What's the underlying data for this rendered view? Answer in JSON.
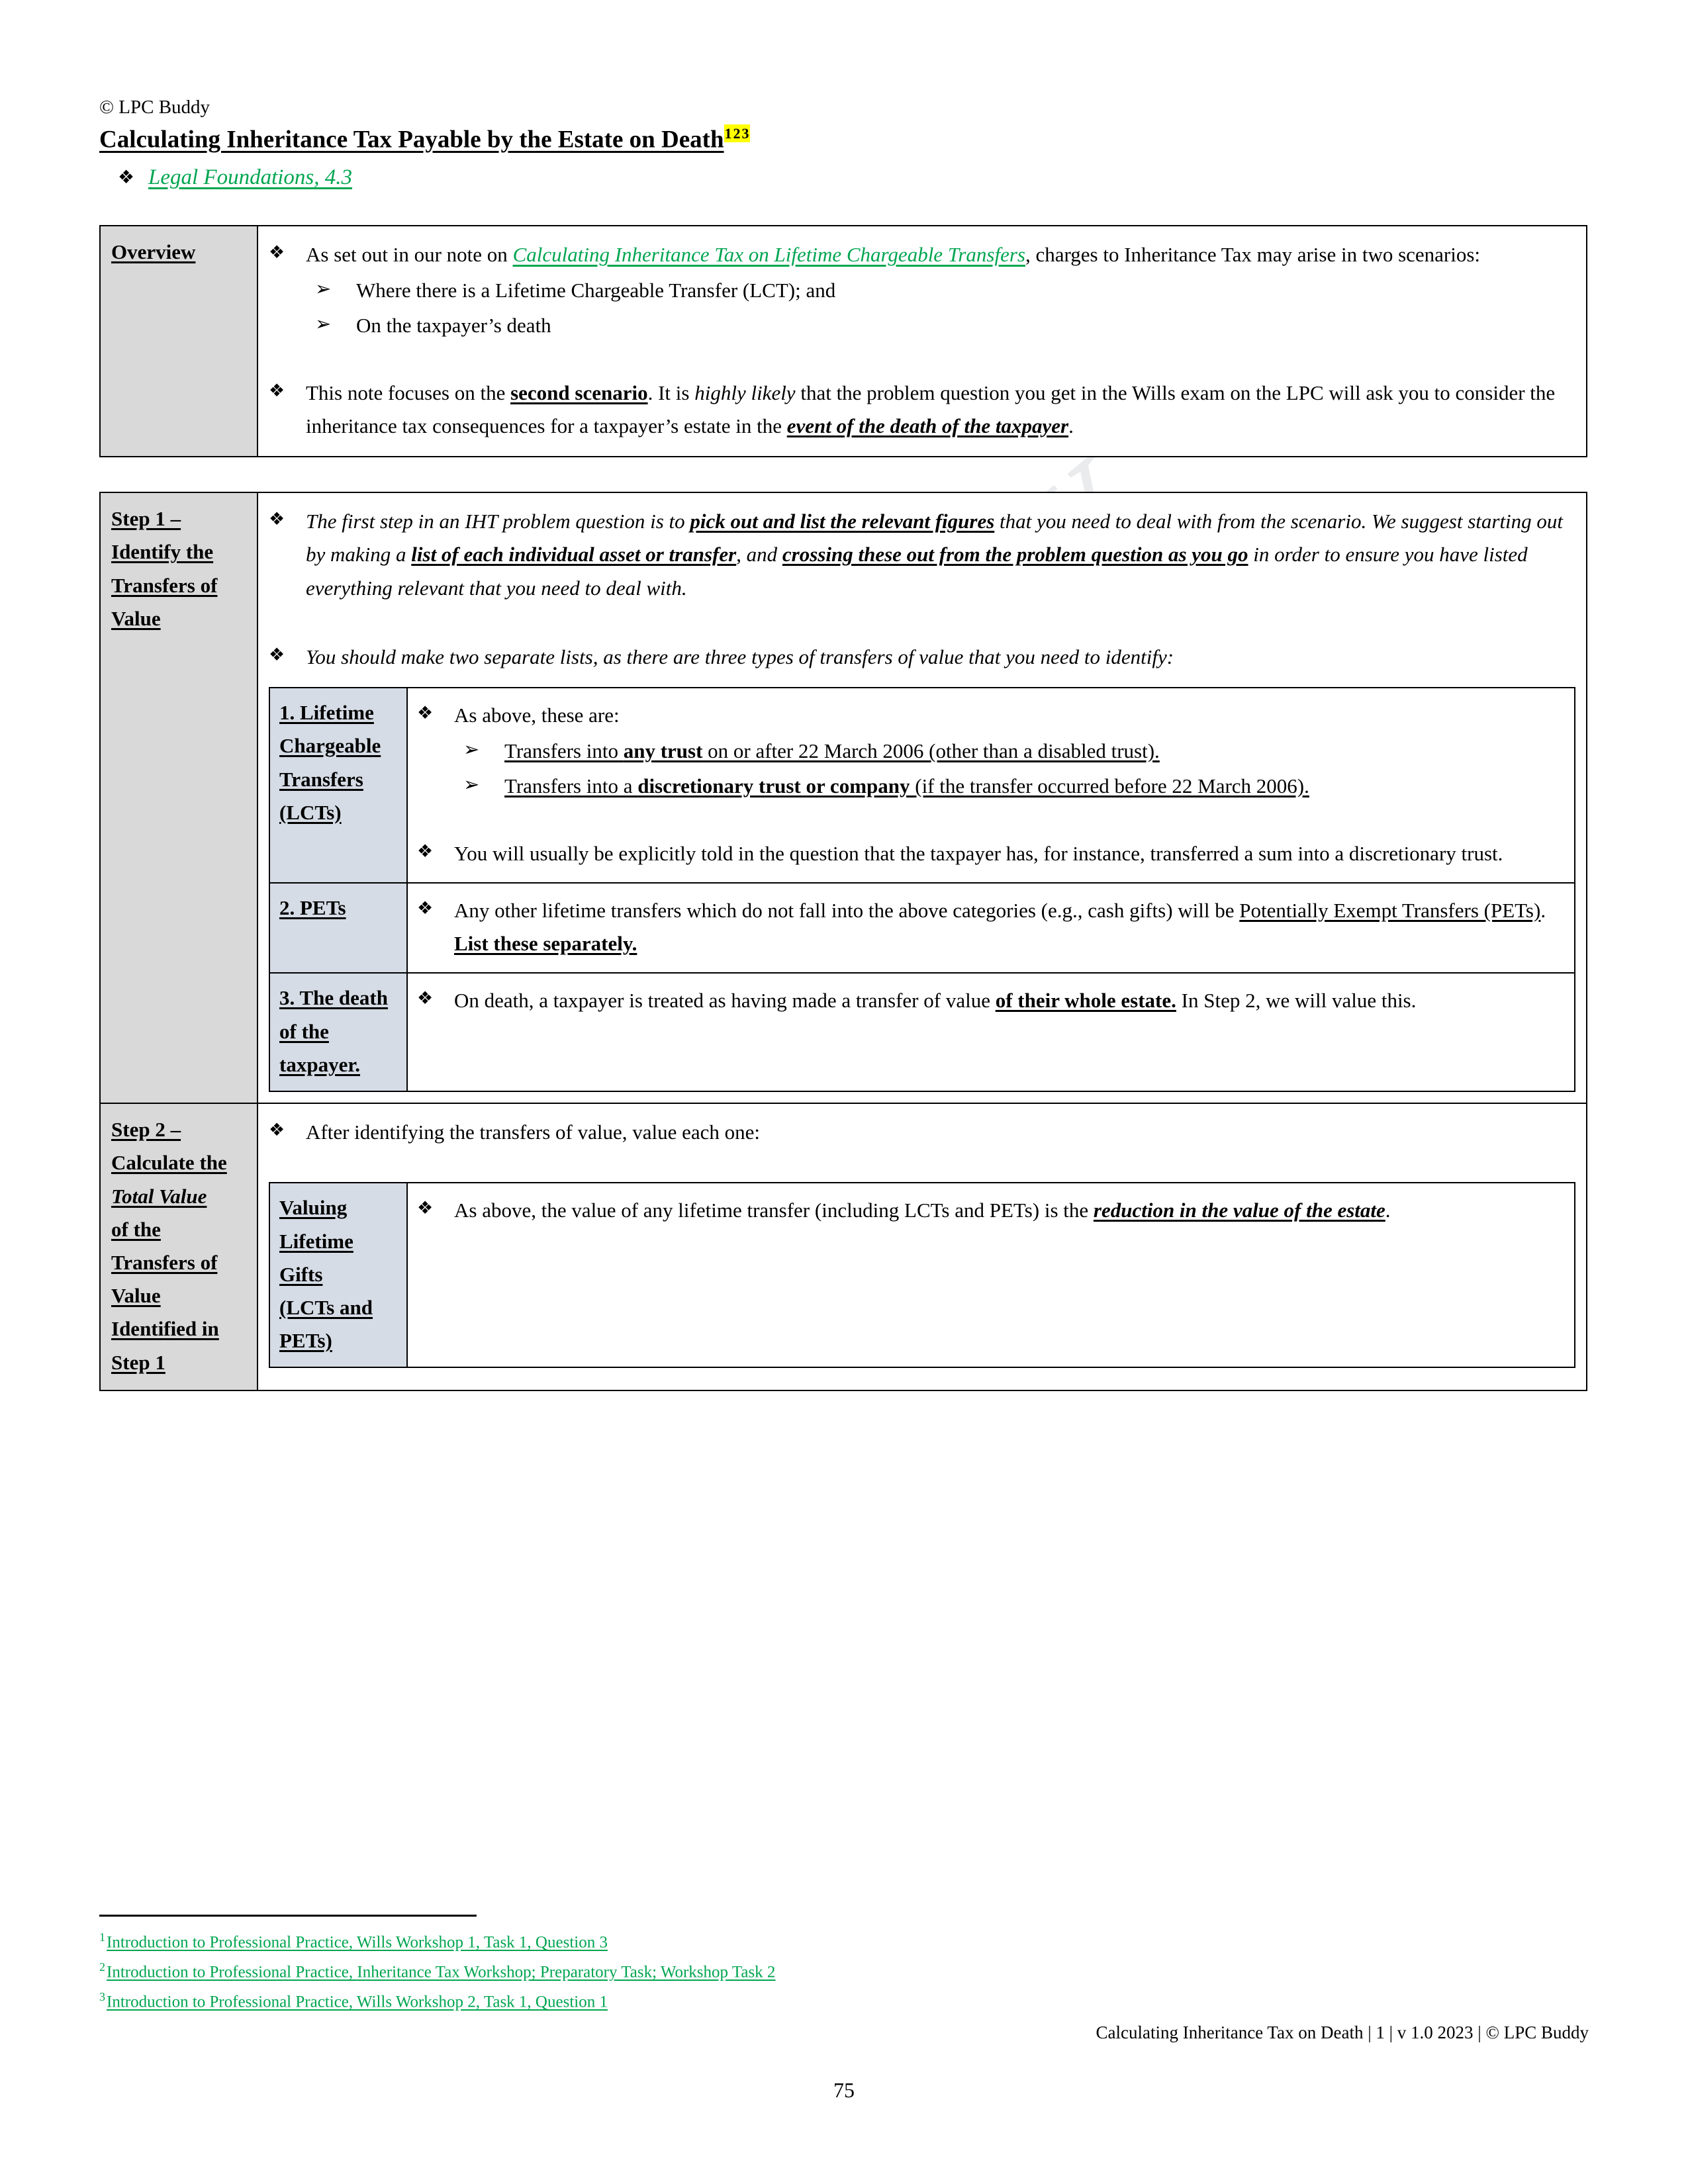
{
  "header": {
    "copyright": "© LPC Buddy",
    "title": "Calculating Inheritance Tax Payable by the Estate on Death",
    "footnote_refs": [
      "1",
      "2",
      "3"
    ],
    "source_link": "Legal Foundations, 4.3",
    "bullet_glyph": "❖"
  },
  "colors": {
    "link_green": "#00a550",
    "highlight_yellow": "#ffff00",
    "label_gray": "#d9d9d9",
    "nested_header_blue": "#d6dce5"
  },
  "watermark": {
    "text": "LPC BUDDY"
  },
  "overview": {
    "label": "Overview",
    "bullet1": {
      "pre": "As set out in our note on ",
      "link": "Calculating Inheritance Tax on Lifetime Chargeable Transfers",
      "post": ", charges to Inheritance Tax may arise in two scenarios:"
    },
    "sub_bullets": [
      "Where there is a Lifetime Chargeable Transfer (LCT); and",
      "On the taxpayer’s death"
    ],
    "bullet2": {
      "p1": "This note focuses on the ",
      "bold_underline": "second scenario",
      "p2": ". It is ",
      "italic": "highly likely",
      "p3": " that the problem question you get in the Wills exam on the LPC will ask you to consider the inheritance tax consequences for a taxpayer’s estate in the ",
      "bold_italic_underline": "event of the death of the taxpayer",
      "p4": "."
    }
  },
  "step1": {
    "label_lines": [
      "Step 1 –",
      "Identify the",
      "Transfers of",
      "Value"
    ],
    "bullet1": {
      "p1": "The first step in an IHT problem question is to ",
      "bu1": "pick out and list the relevant figures",
      "p2": " that you need to deal with from the scenario. We suggest starting out by making a ",
      "bu2": "list of each individual asset or transfer",
      "p3": ", and ",
      "bu3": "crossing these out from the problem question as you go",
      "p4": " in order to ensure you have listed everything relevant that you need to deal with."
    },
    "bullet2": "You should make two separate lists, as there are three types of transfers of value that you need to identify:",
    "nested_rows": [
      {
        "category_lines": [
          "1. Lifetime",
          "Chargeable",
          "Transfers",
          "(LCTs)"
        ],
        "lead": "As above, these are:",
        "sub_bullets": [
          {
            "a": "Transfers into ",
            "b": "any trust",
            "c": " on or after 22 March 2006 (other than a disabled trust)."
          },
          {
            "a": "Transfers into a ",
            "b": "discretionary trust or company",
            "c": " (if the transfer occurred before 22 March 2006)."
          }
        ],
        "trailing": "You will usually be explicitly told in the question that the taxpayer has, for instance, transferred a sum into a discretionary trust."
      },
      {
        "category_lines": [
          "2. PETs"
        ],
        "text": {
          "p1": "Any other lifetime transfers which do not fall into the above categories (e.g., cash gifts) will be ",
          "u1": "Potentially Exempt Transfers (PETs)",
          "p2": ". ",
          "bu1": "List these separately."
        }
      },
      {
        "category_lines": [
          "3. The death",
          "of the",
          "taxpayer."
        ],
        "text": {
          "p1": "On death, a taxpayer is treated as having made a transfer of value ",
          "bu1": "of their whole estate.",
          "p2": " In Step 2, we will value this."
        }
      }
    ]
  },
  "step2": {
    "label_lines": [
      "Step 2 –",
      "Calculate the",
      "Total Value",
      "of the",
      "Transfers of",
      "Value",
      "Identified in",
      "Step 1"
    ],
    "label_italic_index": 2,
    "bullet1": "After identifying the transfers of value, value each one:",
    "nested_rows": [
      {
        "category_lines": [
          "Valuing",
          "Lifetime",
          "Gifts",
          "(LCTs and",
          "PETs)"
        ],
        "text": {
          "p1": "As above, the value of any lifetime transfer (including LCTs and PETs) is the ",
          "biu": "reduction in the value of the estate",
          "p2": "."
        }
      }
    ]
  },
  "footnotes": [
    {
      "num": "1",
      "text": "Introduction to Professional Practice, Wills Workshop 1, Task 1, Question 3"
    },
    {
      "num": "2",
      "text": "Introduction to Professional Practice, Inheritance Tax Workshop; Preparatory Task; Workshop Task 2"
    },
    {
      "num": "3",
      "text": "Introduction to Professional Practice, Wills Workshop 2, Task 1, Question 1"
    }
  ],
  "footer": {
    "text": "Calculating Inheritance Tax on Death | 1 | v 1.0 2023 | © LPC Buddy",
    "page_number": "75"
  }
}
